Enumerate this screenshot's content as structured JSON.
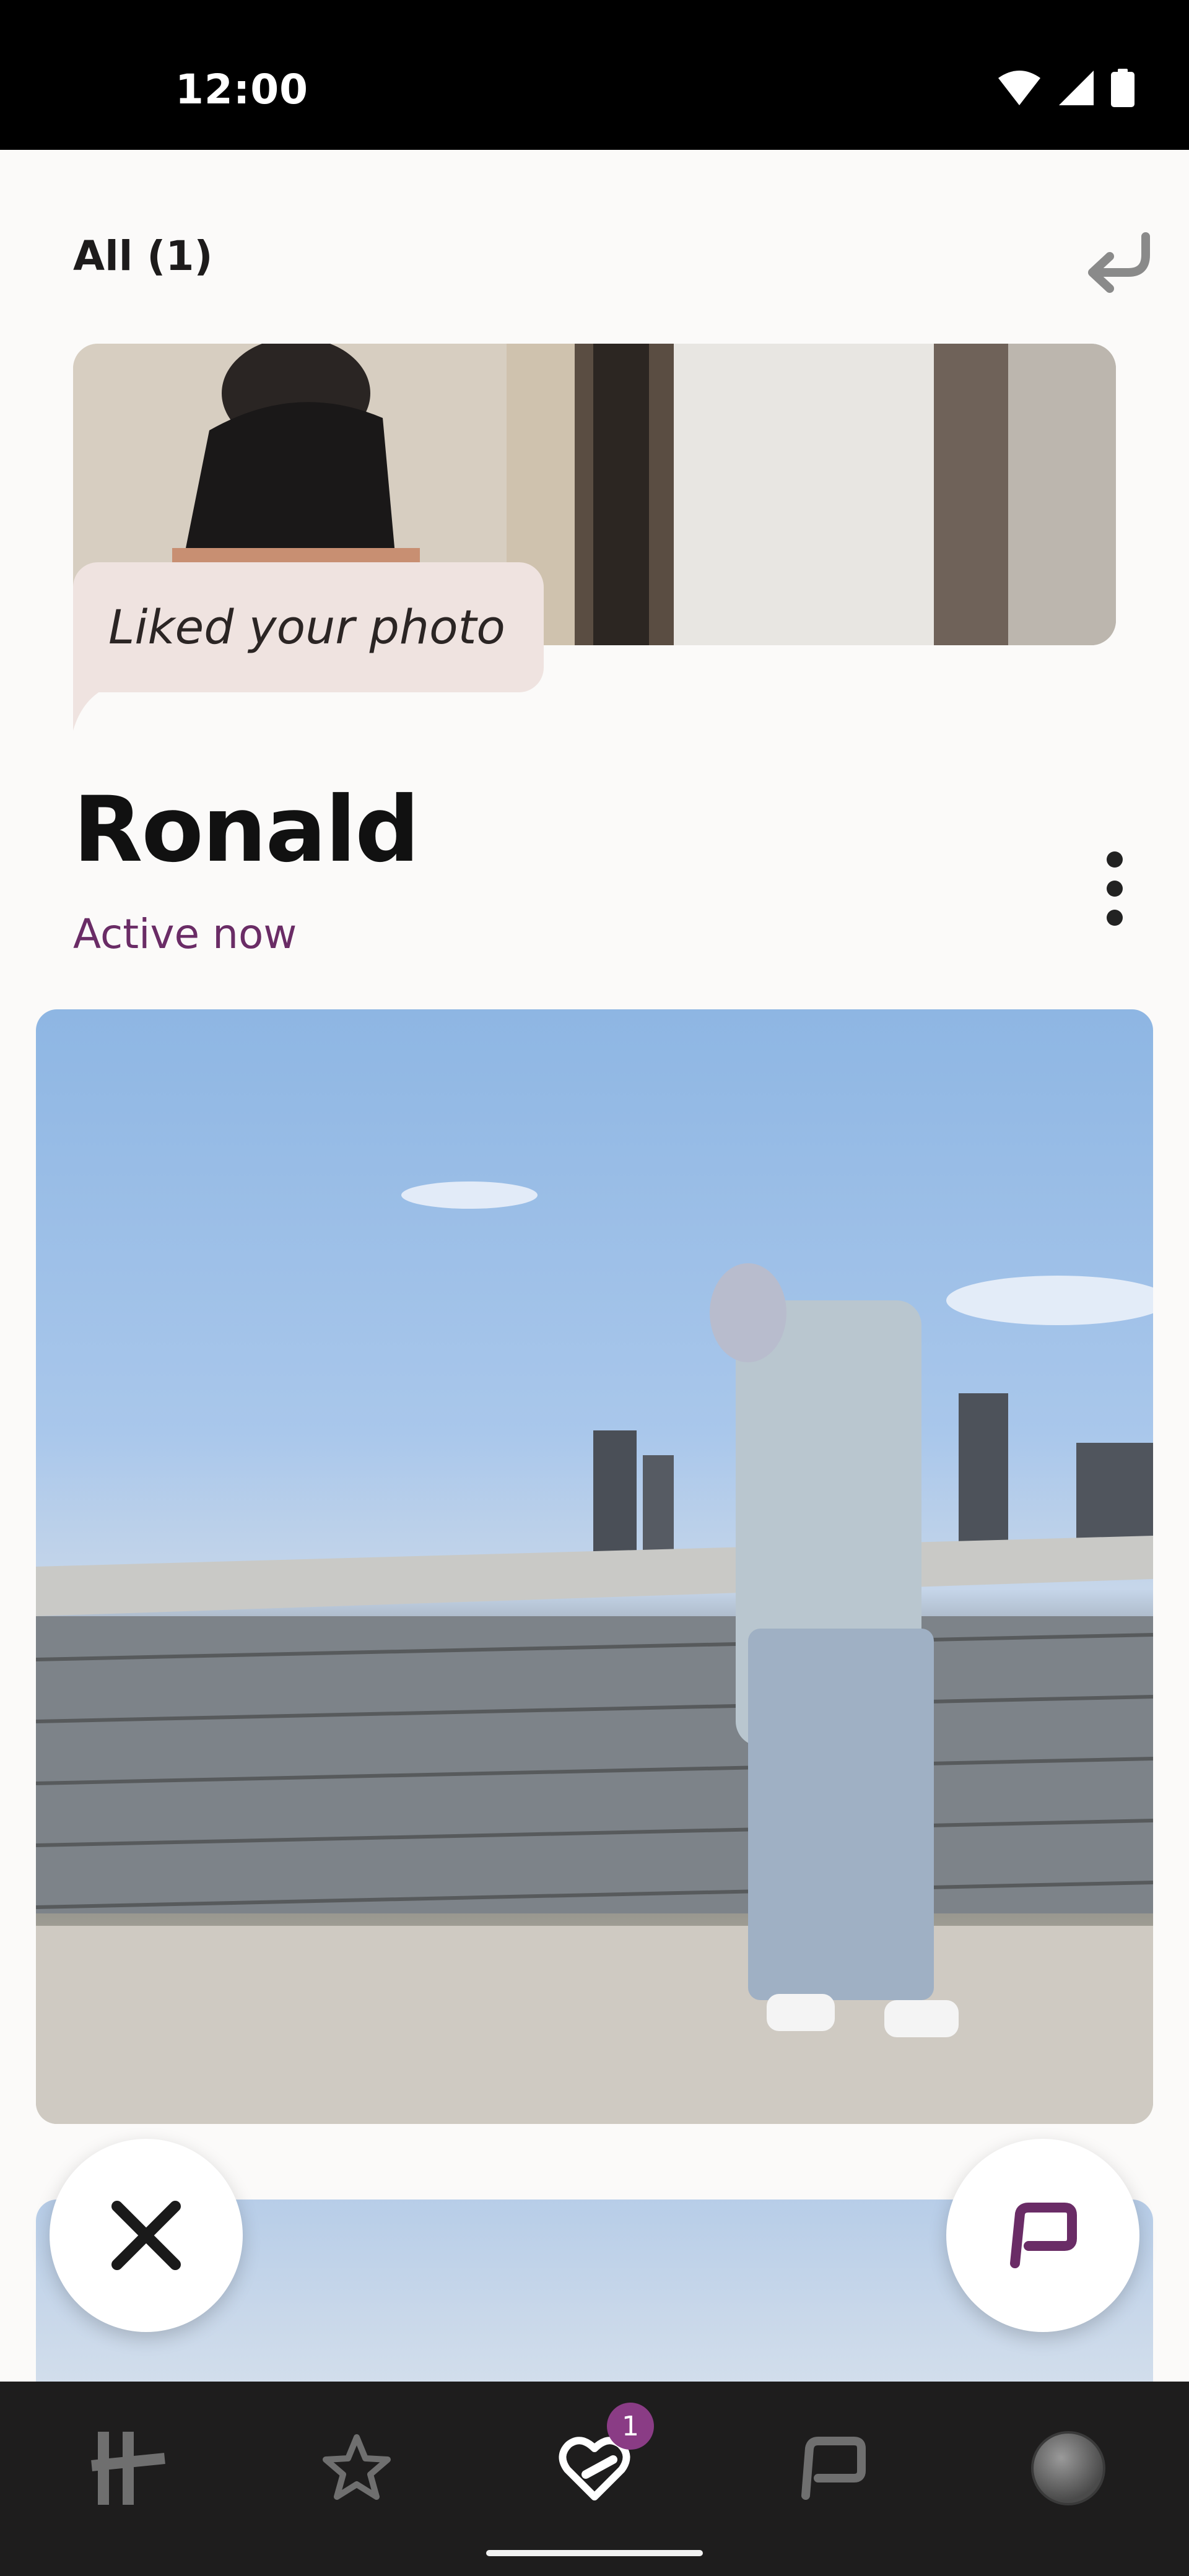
{
  "status_bar": {
    "time": "12:00",
    "icons": [
      "wifi-icon",
      "signal-icon",
      "battery-icon"
    ]
  },
  "header": {
    "filter_label": "All (1)",
    "back_icon": "undo-arrow-icon"
  },
  "liked_card": {
    "message": "Liked your photo"
  },
  "profile": {
    "name": "Ronald",
    "status": "Active now",
    "menu_icon": "more-vertical-icon"
  },
  "actions": {
    "pass_icon": "close-icon",
    "comment_icon": "chat-bubble-icon"
  },
  "bottom_nav": {
    "items": [
      {
        "name": "discover",
        "icon": "hinge-logo-icon"
      },
      {
        "name": "standouts",
        "icon": "star-icon"
      },
      {
        "name": "likes-you",
        "icon": "heart-icon",
        "badge": "1",
        "active": true
      },
      {
        "name": "matches",
        "icon": "chat-bubble-icon"
      },
      {
        "name": "profile",
        "icon": "avatar-icon"
      }
    ]
  },
  "colors": {
    "accent": "#6a2c66",
    "badge": "#8a3c85",
    "bubble": "#efe3e0",
    "nav_bg": "#1e1d1d"
  }
}
